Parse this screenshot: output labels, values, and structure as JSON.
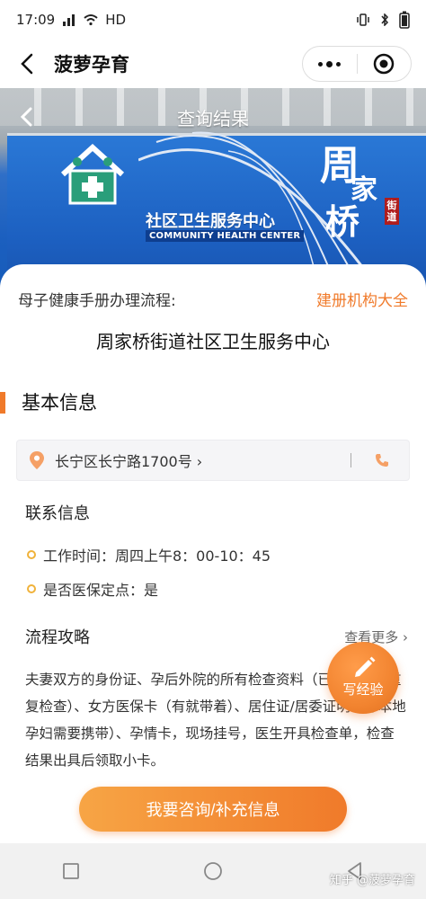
{
  "status_bar": {
    "time": "17:09",
    "network": "HD"
  },
  "title_bar": {
    "title": "菠萝孕育"
  },
  "banner": {
    "overlay_title": "查询结果",
    "center_name_cn": "社区卫生服务中心",
    "center_name_en": "COMMUNITY HEALTH CENTER",
    "sign_chars": [
      "周",
      "家",
      "桥"
    ],
    "sign_tag": "街道"
  },
  "content": {
    "flow_label": "母子健康手册办理流程:",
    "institutions_link": "建册机构大全",
    "center_name": "周家桥街道社区卫生服务中心",
    "basic_info_title": "基本信息",
    "address": "长宁区长宁路1700号 ›",
    "contact_title": "联系信息",
    "work_hours": "工作时间：周四上午8：00-10：45",
    "insurance": "是否医保定点：是",
    "guide_title": "流程攻略",
    "see_more": "查看更多 ›",
    "guide_text": "夫妻双方的身份证、孕后外院的所有检查资料（已做检查不重复检查）、女方医保卡（有就带着）、居住证/居委证明（非本地孕妇需要携带）、孕情卡，现场挂号，医生开具检查单，检查结果出具后领取小卡。"
  },
  "fab": {
    "label": "写经验"
  },
  "cta": {
    "label": "我要咨询/补充信息"
  },
  "watermark": "知乎 @菠萝孕育",
  "colors": {
    "accent": "#f07a2a",
    "dot": "#f0b23a",
    "banner_blue": "#1c5fc0"
  }
}
